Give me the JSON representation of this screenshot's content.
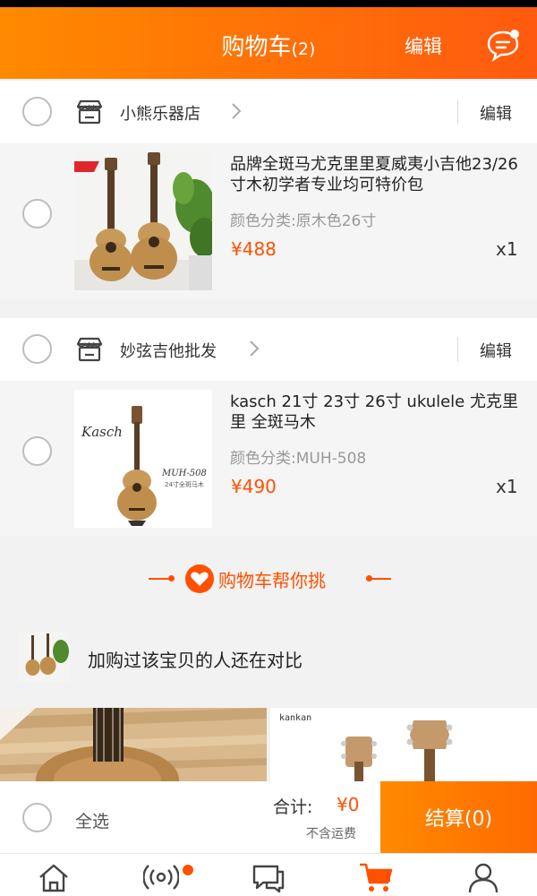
{
  "header": {
    "title": "购物车",
    "count": "(2)",
    "edit_label": "编辑"
  },
  "shops": [
    {
      "name": "小熊乐器店",
      "edit_label": "编辑",
      "item": {
        "title": "品牌全斑马尤克里里夏威夷小吉他23/26寸木初学者专业均可特价包",
        "sku": "颜色分类:原木色26寸",
        "price": "¥488",
        "qty": "x1"
      }
    },
    {
      "name": "妙弦吉他批发",
      "edit_label": "编辑",
      "item": {
        "title": "kasch 21寸 23寸 26寸 ukulele 尤克里里 全斑马木",
        "sku": "颜色分类:MUH-508",
        "price": "¥490",
        "qty": "x1",
        "image_brand": "Kasch",
        "image_model": "MUH-508",
        "image_caption": "24寸全斑马木"
      }
    }
  ],
  "helper": {
    "label": "购物车帮你挑"
  },
  "compare": {
    "text": "加购过该宝贝的人还在对比"
  },
  "recommendations": {
    "rec2_brand": "kankan"
  },
  "footer": {
    "select_all": "全选",
    "total_label": "合计:",
    "total_value": "¥0",
    "shipping_note": "不含运费",
    "checkout_label": "结算(0)"
  },
  "tabs": [
    "home-icon",
    "live-icon",
    "messages-icon",
    "cart-icon",
    "profile-icon"
  ],
  "colors": {
    "accent": "#ff5000",
    "header_start": "#ff8a00",
    "header_end": "#ff5a0f"
  }
}
